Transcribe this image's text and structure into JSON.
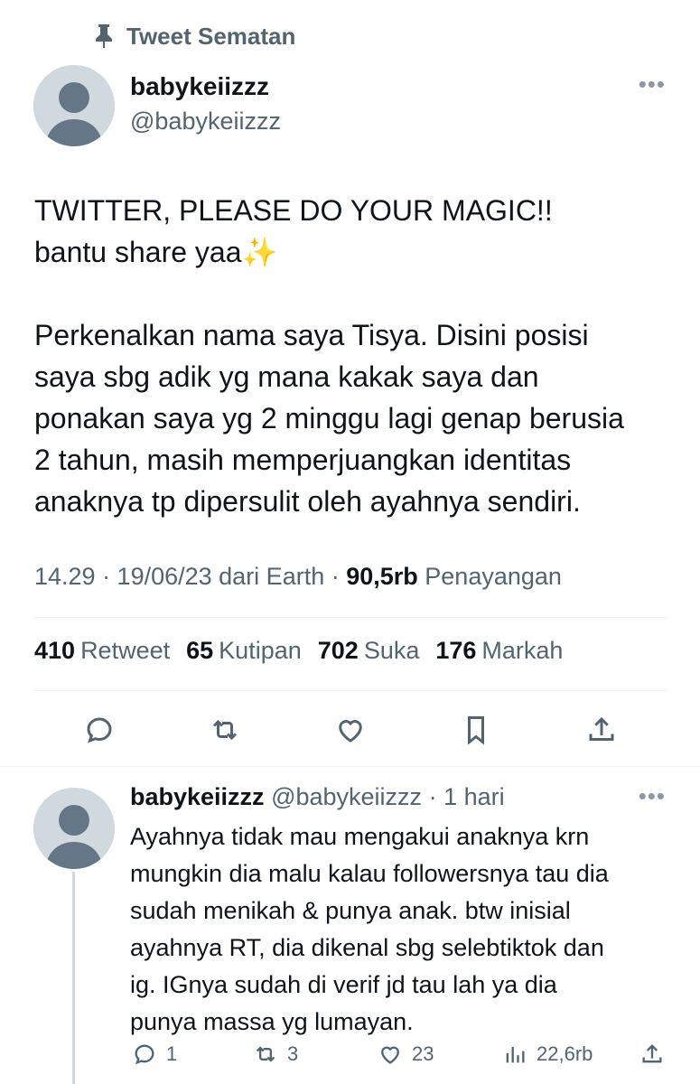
{
  "pinned": {
    "label": "Tweet Sematan",
    "icon": "pin-icon"
  },
  "tweet": {
    "author_name": "babykeiizzz",
    "author_handle": "@babykeiizzz",
    "text_line1": "TWITTER, PLEASE DO YOUR MAGIC!!",
    "text_line2": "bantu share yaa",
    "sparkle_emoji": "✨",
    "text_body": "Perkenalkan nama saya Tisya. Disini posisi\nsaya sbg adik yg mana kakak saya dan\nponakan saya yg 2 minggu lagi genap berusia\n2 tahun, masih memperjuangkan identitas\nanaknya tp dipersulit oleh ayahnya sendiri.",
    "meta_prefix": "14.29 · 19/06/23 dari Earth · ",
    "views_count": "90,5rb",
    "views_label": " Penayangan",
    "stats": {
      "retweets_count": "410",
      "retweets_label": "Retweet",
      "quotes_count": "65",
      "quotes_label": "Kutipan",
      "likes_count": "702",
      "likes_label": "Suka",
      "bookmarks_count": "176",
      "bookmarks_label": "Markah"
    },
    "actions": [
      "reply-icon",
      "retweet-icon",
      "like-icon",
      "bookmark-icon",
      "share-icon"
    ]
  },
  "reply": {
    "author_name": "babykeiizzz",
    "author_handle": "@babykeiizzz",
    "time": "· 1 hari",
    "text": "Ayahnya tidak mau mengakui anaknya krn\nmungkin dia malu kalau followersnya tau dia\nsudah menikah & punya anak. btw inisial\nayahnya RT, dia dikenal sbg selebtiktok dan\nig. IGnya sudah di verif jd tau lah ya dia\npunya massa yg lumayan.",
    "replies": "1",
    "retweets": "3",
    "likes": "23",
    "views": "22,6rb"
  },
  "colors": {
    "text": "#0f1419",
    "secondary": "#536471",
    "avatar_bg": "#cfd9de",
    "divider": "#eff3f4"
  }
}
